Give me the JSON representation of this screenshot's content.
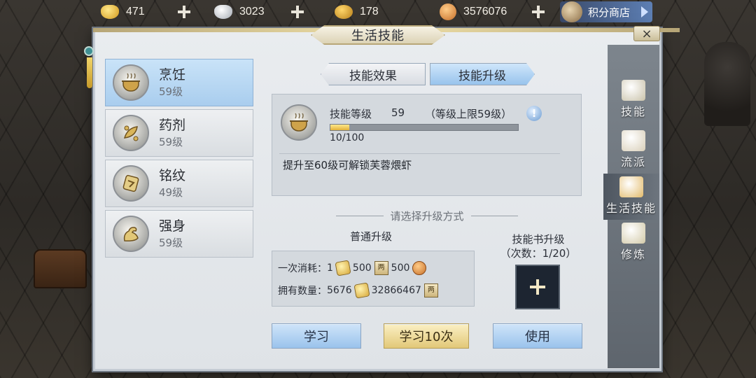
{
  "currencies": [
    {
      "name": "gold-ingot",
      "value": "471"
    },
    {
      "name": "silver-ingot",
      "value": "3023"
    },
    {
      "name": "treasure-bag",
      "value": "178"
    },
    {
      "name": "copper-coin",
      "value": "3576076"
    }
  ],
  "shop": {
    "label": "积分商店"
  },
  "window": {
    "title": "生活技能",
    "close": "×"
  },
  "skills": [
    {
      "name": "烹饪",
      "level": "59级",
      "icon": "cooking-pot-icon"
    },
    {
      "name": "药剂",
      "level": "59级",
      "icon": "herb-icon"
    },
    {
      "name": "铭纹",
      "level": "49级",
      "icon": "inscription-icon"
    },
    {
      "name": "强身",
      "level": "59级",
      "icon": "strength-icon"
    }
  ],
  "tabs": {
    "effect": "技能效果",
    "upgrade": "技能升级"
  },
  "info": {
    "level_label": "技能等级",
    "level_value": "59",
    "level_cap": "（等级上限59级）",
    "alert": "!",
    "progress_text": "10/100",
    "progress_fraction": 0.1,
    "unlock_text": "提升至60级可解锁芙蓉煨虾"
  },
  "upgrade": {
    "section_title": "请选择升级方式",
    "normal_title": "普通升级",
    "book_title": "技能书升级",
    "book_count": "（次数：1/20）",
    "cost_label": "一次消耗：",
    "cost_scroll": "1",
    "cost_book": "500",
    "cost_coin": "500",
    "owned_label": "拥有数量：",
    "owned_scroll": "5676",
    "owned_book": "32866467",
    "book_glyph": "两"
  },
  "buttons": {
    "learn": "学习",
    "learn10": "学习10次",
    "use": "使用"
  },
  "side_tabs": [
    {
      "label": "技能",
      "color": "#c9c2aa"
    },
    {
      "label": "流派",
      "color": "#d9cfb9"
    },
    {
      "label": "生活技能",
      "color": "#e2ba6a"
    },
    {
      "label": "修炼",
      "color": "#d2c9a8"
    }
  ]
}
